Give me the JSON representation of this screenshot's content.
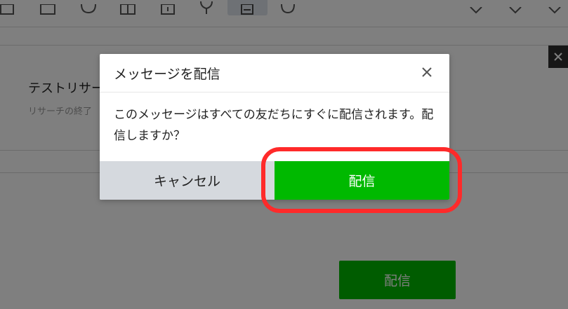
{
  "background": {
    "research_title": "テストリサー",
    "research_subtitle": "リサーチの終了",
    "send_label": "配信"
  },
  "dialog": {
    "title": "メッセージを配信",
    "message": "このメッセージはすべての友だちにすぐに配信されます。配信しますか？",
    "cancel_label": "キャンセル",
    "send_label": "配信"
  },
  "colors": {
    "accent_green": "#00b900",
    "highlight_red": "#ff2a2a",
    "cancel_gray": "#d5d9de"
  },
  "icons": [
    "list-icon",
    "image-icon",
    "chat-icon",
    "grid-icon",
    "card-icon",
    "location-icon",
    "research-icon",
    "speech-icon",
    "chevron-icon",
    "close-icon"
  ]
}
